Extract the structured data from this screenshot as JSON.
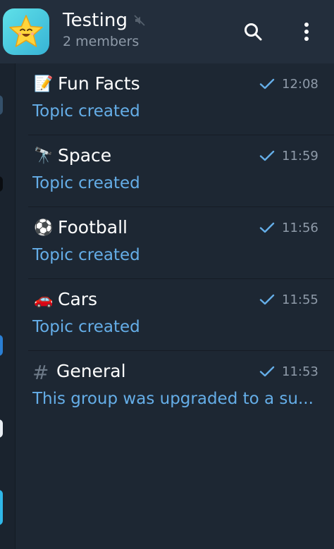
{
  "header": {
    "title": "Testing",
    "subtitle": "2 members",
    "avatar_icon": "star-face-icon",
    "muted_icon": "muted-speaker-icon",
    "actions": [
      "search-icon",
      "more-vertical-icon"
    ]
  },
  "topics": [
    {
      "emoji": "📝",
      "name": "Fun Facts",
      "time": "12:08",
      "subtitle": "Topic created"
    },
    {
      "emoji": "🔭",
      "name": "Space",
      "time": "11:59",
      "subtitle": "Topic created"
    },
    {
      "emoji": "⚽",
      "name": "Football",
      "time": "11:56",
      "subtitle": "Topic created"
    },
    {
      "emoji": "🚗",
      "name": "Cars",
      "time": "11:55",
      "subtitle": "Topic created"
    },
    {
      "emoji": "#",
      "name": "General",
      "time": "11:53",
      "subtitle": "This group was upgraded to a su..."
    }
  ],
  "colors": {
    "background": "#1d2733",
    "header": "#232e3c",
    "link_blue": "#65aee8",
    "muted_text": "#8e9aa8"
  }
}
